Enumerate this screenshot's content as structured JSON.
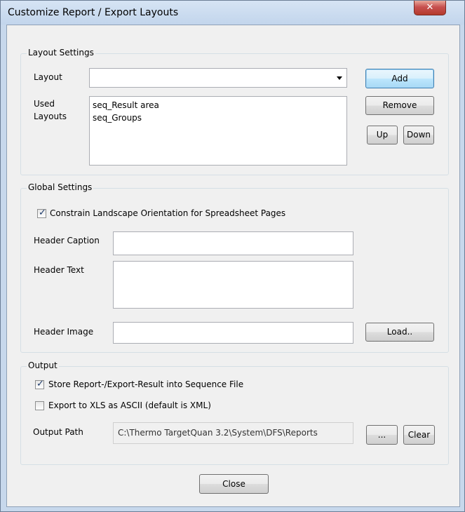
{
  "window": {
    "title": "Customize Report / Export Layouts",
    "close_glyph": "✕"
  },
  "layout_settings": {
    "group_label": "Layout Settings",
    "layout_label": "Layout",
    "layout_value": "",
    "used_layouts_label_1": "Used",
    "used_layouts_label_2": "Layouts",
    "used_layouts": [
      "seq_Result area",
      "seq_Groups"
    ],
    "add_label": "Add",
    "remove_label": "Remove",
    "up_label": "Up",
    "down_label": "Down"
  },
  "global_settings": {
    "group_label": "Global Settings",
    "constrain_label": "Constrain Landscape Orientation for Spreadsheet Pages",
    "constrain_checked": true,
    "header_caption_label": "Header Caption",
    "header_caption_value": "",
    "header_text_label": "Header Text",
    "header_text_value": "",
    "header_image_label": "Header Image",
    "header_image_value": "",
    "load_label": "Load.."
  },
  "output": {
    "group_label": "Output",
    "store_label": "Store Report-/Export-Result into Sequence File",
    "store_checked": true,
    "export_xls_label": "Export to XLS as ASCII (default is XML)",
    "export_xls_checked": false,
    "output_path_label": "Output Path",
    "output_path_value": "C:\\Thermo TargetQuan 3.2\\System\\DFS\\Reports",
    "browse_label": "...",
    "clear_label": "Clear"
  },
  "footer": {
    "close_label": "Close"
  },
  "checkmark_glyph": "✓"
}
